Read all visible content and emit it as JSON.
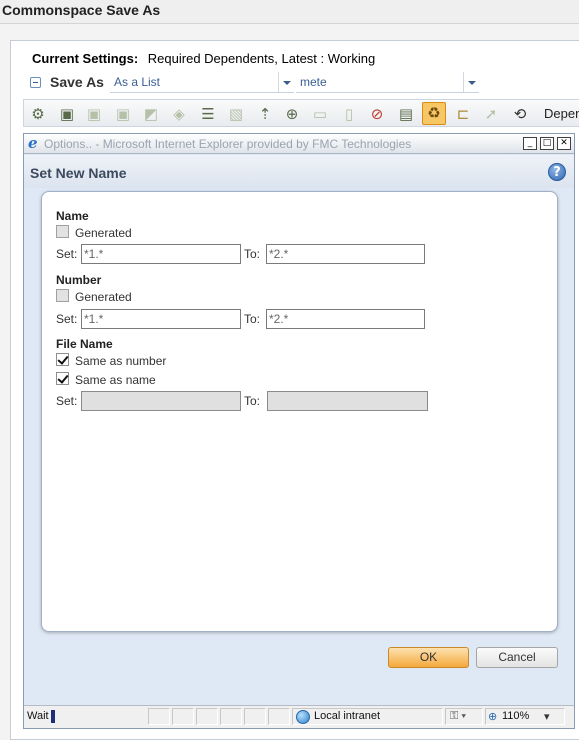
{
  "page": {
    "title": "Commonspace Save As",
    "current_settings_label": "Current Settings:",
    "current_settings_value": "Required Dependents, Latest : Working",
    "save_as_label": "Save As",
    "combo_mode": "As a List",
    "combo_user": "mete",
    "toolbar_trailing_label": "Depen"
  },
  "dialog": {
    "title": "Options.. - Microsoft Internet Explorer provided by FMC Technologies",
    "heading": "Set New Name",
    "help_symbol": "?",
    "name_section": {
      "title": "Name",
      "generated_label": "Generated",
      "generated_checked": false,
      "set_label": "Set:",
      "set_value": "*1.*",
      "to_label": "To:",
      "to_value": "*2.*"
    },
    "number_section": {
      "title": "Number",
      "generated_label": "Generated",
      "generated_checked": false,
      "set_label": "Set:",
      "set_value": "*1.*",
      "to_label": "To:",
      "to_value": "*2.*"
    },
    "file_name_section": {
      "title": "File Name",
      "same_as_number_label": "Same as number",
      "same_as_number_checked": true,
      "same_as_name_label": "Same as name",
      "same_as_name_checked": true,
      "set_label": "Set:",
      "set_value": "",
      "to_label": "To:",
      "to_value": ""
    },
    "ok_label": "OK",
    "cancel_label": "Cancel",
    "status": {
      "text": "Wait",
      "zone": "Local intranet",
      "zoom": "110%"
    }
  },
  "colors": {
    "ok_button": "#f5a83c",
    "dialog_background": "#dfe8f5",
    "link_blue": "#3a5f93"
  }
}
